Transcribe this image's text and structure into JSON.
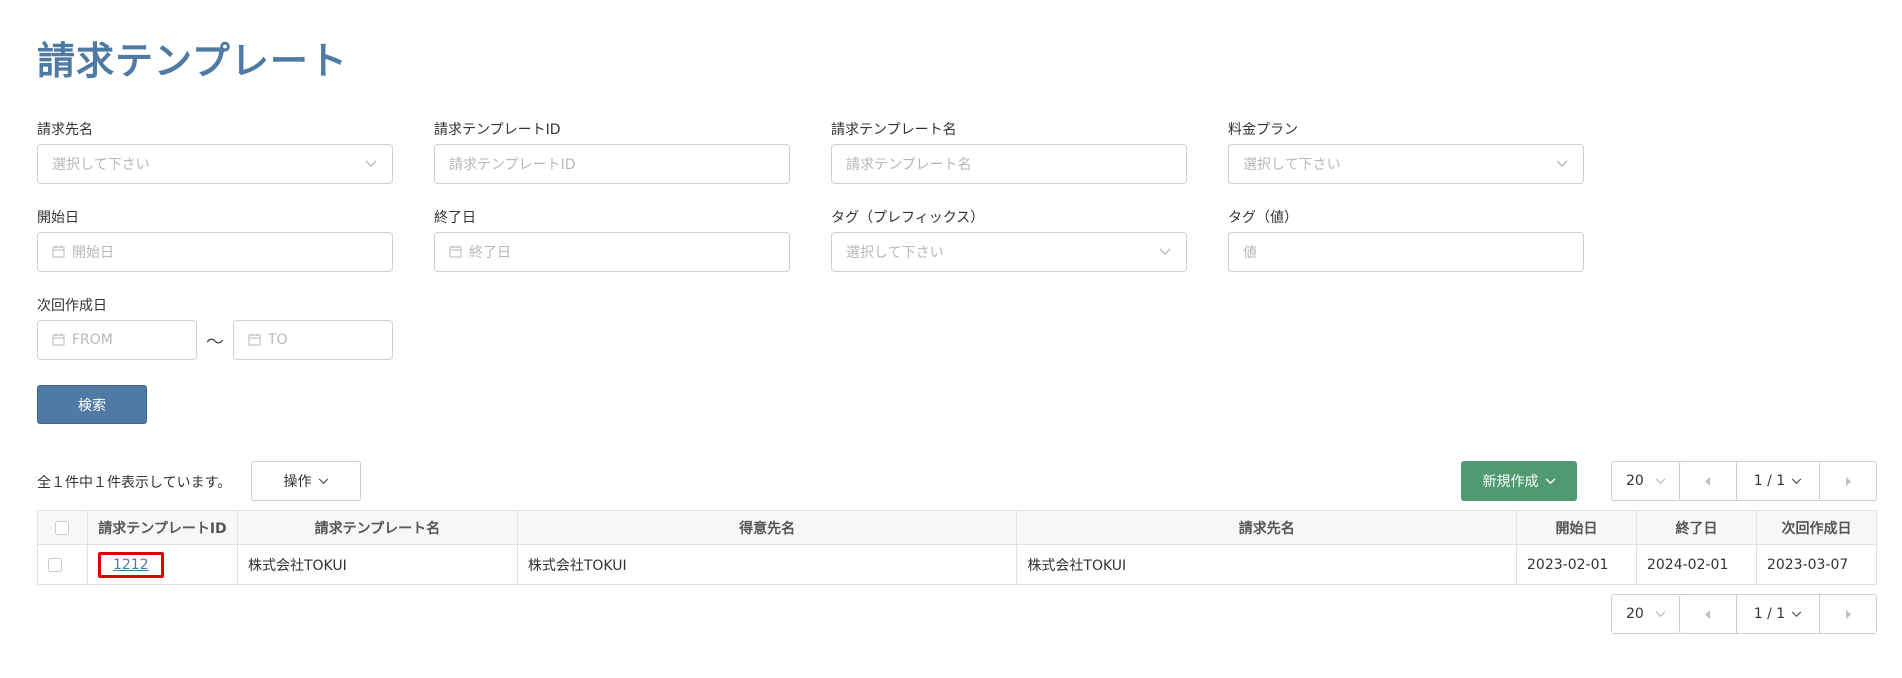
{
  "page": {
    "title": "請求テンプレート"
  },
  "filters": {
    "billing_to": {
      "label": "請求先名",
      "placeholder": "選択して下さい"
    },
    "template_id": {
      "label": "請求テンプレートID",
      "placeholder": "請求テンプレートID"
    },
    "template_name": {
      "label": "請求テンプレート名",
      "placeholder": "請求テンプレート名"
    },
    "price_plan": {
      "label": "料金プラン",
      "placeholder": "選択して下さい"
    },
    "start_date": {
      "label": "開始日",
      "placeholder": "開始日"
    },
    "end_date": {
      "label": "終了日",
      "placeholder": "終了日"
    },
    "tag_prefix": {
      "label": "タグ（プレフィックス）",
      "placeholder": "選択して下さい"
    },
    "tag_value": {
      "label": "タグ（値）",
      "placeholder": "値"
    },
    "next_created": {
      "label": "次回作成日",
      "from_placeholder": "FROM",
      "to_placeholder": "TO",
      "separator": "～"
    }
  },
  "search_button": "検索",
  "results": {
    "count_text": "全１件中１件表示しています。",
    "operations_label": "操作",
    "new_button_label": "新規作成",
    "page_size": "20",
    "page_indicator": "1 / 1"
  },
  "table": {
    "headers": [
      "請求テンプレートID",
      "請求テンプレート名",
      "得意先名",
      "請求先名",
      "開始日",
      "終了日",
      "次回作成日"
    ],
    "rows": [
      {
        "id": "1212",
        "template_name": "株式会社TOKUI",
        "customer_name": "株式会社TOKUI",
        "billing_name": "株式会社TOKUI",
        "start": "2023-02-01",
        "end": "2024-02-01",
        "next": "2023-03-07"
      }
    ]
  },
  "colors": {
    "primary": "#4e7aa3",
    "success": "#4f9a6f",
    "highlight": "#e00000"
  }
}
